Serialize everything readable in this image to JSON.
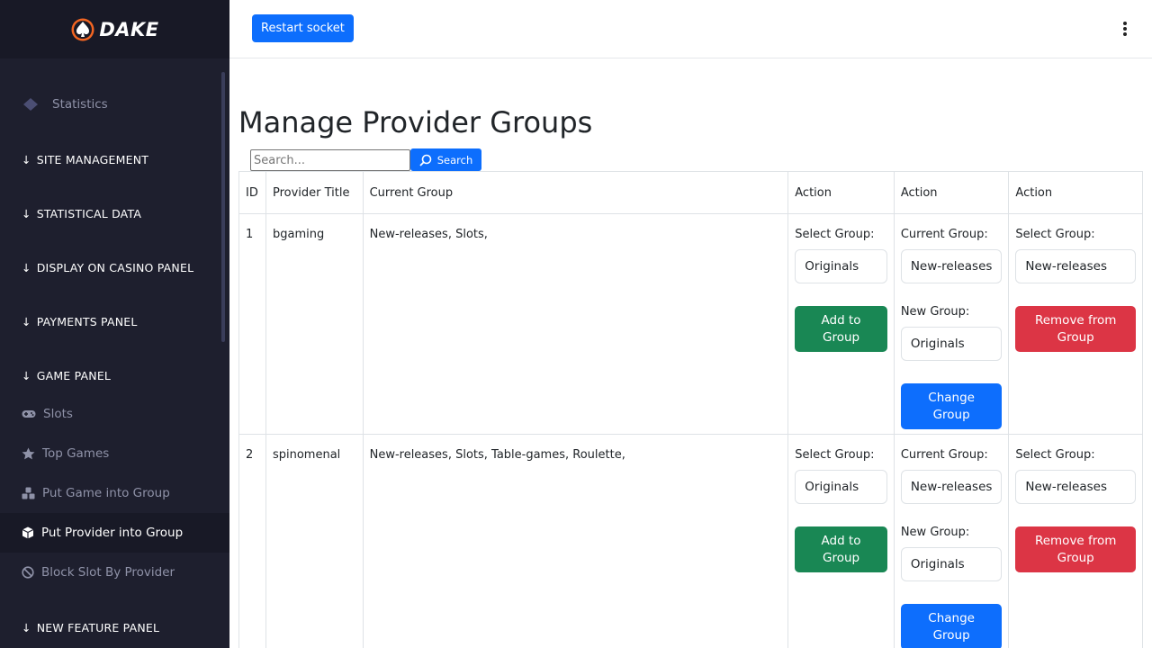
{
  "brand": {
    "name": "DAKE"
  },
  "topbar": {
    "restart_label": "Restart socket"
  },
  "sidebar": {
    "statistics": "Statistics",
    "sections": {
      "site_management": "SITE MANAGEMENT",
      "statistical_data": "STATISTICAL DATA",
      "display_on_casino_panel": "DISPLAY ON CASINO PANEL",
      "payments_panel": "PAYMENTS PANEL",
      "game_panel": "GAME PANEL",
      "new_feature_panel": "NEW FEATURE PANEL"
    },
    "items": {
      "slots": "Slots",
      "top_games": "Top Games",
      "put_game_into_group": "Put Game into Group",
      "put_provider_into_group": "Put Provider into Group",
      "block_slot_by_provider": "Block Slot By Provider"
    }
  },
  "main": {
    "title": "Manage Provider Groups",
    "search": {
      "placeholder": "Search...",
      "button": "Search"
    },
    "table": {
      "headers": [
        "ID",
        "Provider Title",
        "Current Group",
        "Action",
        "Action",
        "Action"
      ],
      "labels": {
        "select_group": "Select Group:",
        "current_group": "Current Group:",
        "new_group": "New Group:",
        "add": "Add to Group",
        "change": "Change Group",
        "remove": "Remove from Group"
      },
      "rows": [
        {
          "id": "1",
          "provider": "bgaming",
          "current": "New-releases, Slots,",
          "add_select": "Originals",
          "change_current": "New-releases",
          "change_new": "Originals",
          "remove_select": "New-releases"
        },
        {
          "id": "2",
          "provider": "spinomenal",
          "current": "New-releases, Slots, Table-games, Roulette,",
          "add_select": "Originals",
          "change_current": "New-releases",
          "change_new": "Originals",
          "remove_select": "New-releases"
        }
      ]
    }
  },
  "colors": {
    "sidebar_bg": "#1e1f2e",
    "primary": "#0d6efd",
    "success": "#198754",
    "danger": "#dc3545",
    "brand_accent": "#f26522"
  }
}
